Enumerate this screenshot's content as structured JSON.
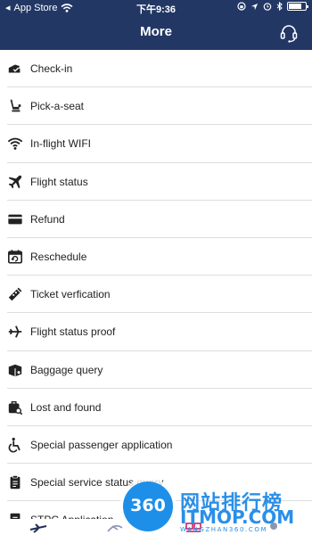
{
  "status_bar": {
    "carrier": "App Store",
    "time": "下午9:36"
  },
  "header": {
    "title": "More",
    "support_icon": "headset-icon"
  },
  "menu": {
    "items": [
      {
        "label": "Check-in",
        "icon": "checkin-icon"
      },
      {
        "label": "Pick-a-seat",
        "icon": "seat-icon"
      },
      {
        "label": "In-flight WIFI",
        "icon": "wifi-icon"
      },
      {
        "label": "Flight status",
        "icon": "airplane-icon"
      },
      {
        "label": "Refund",
        "icon": "card-icon"
      },
      {
        "label": "Reschedule",
        "icon": "calendar-icon"
      },
      {
        "label": "Ticket verfication",
        "icon": "ticket-icon"
      },
      {
        "label": "Flight status proof",
        "icon": "flight-proof-icon"
      },
      {
        "label": "Baggage query",
        "icon": "baggage-icon"
      },
      {
        "label": "Lost and found",
        "icon": "lost-found-icon"
      },
      {
        "label": "Special passenger application",
        "icon": "accessibility-icon"
      },
      {
        "label": "Special service status query",
        "icon": "clipboard-icon"
      },
      {
        "label": "STPC Application",
        "icon": "document-icon"
      }
    ]
  },
  "watermark": {
    "badge": "360",
    "title": "网站排行榜",
    "site": "ITMOP.COM",
    "url": "WANGZHAN360.COM"
  },
  "colors": {
    "header_bg": "#223764",
    "divider": "#dddddd"
  }
}
